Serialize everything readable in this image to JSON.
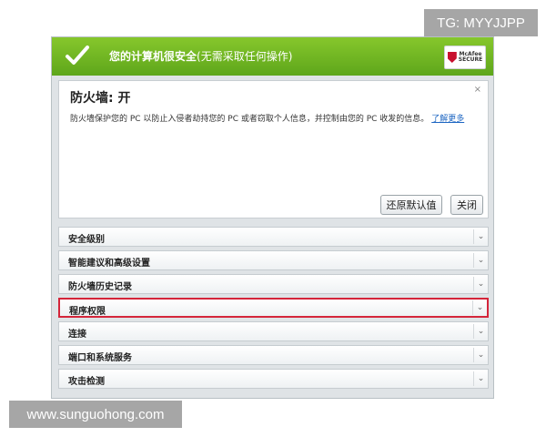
{
  "watermark_tg": "TG: MYYJJPP",
  "watermark_site": "www.sunguohong.com",
  "banner": {
    "status_main": "您的计算机很安全",
    "status_sub": "(无需采取任何操作)",
    "logo_line1": "McAfee",
    "logo_line2": "SECURE"
  },
  "firewall": {
    "title": "防火墙: 开",
    "description": "防火墙保护您的 PC 以防止入侵者劫持您的 PC 或者窃取个人信息，并控制由您的 PC 收发的信息。",
    "learn_more": "了解更多",
    "close_x": "×",
    "restore_button": "还原默认值",
    "close_button": "关闭"
  },
  "sections": [
    {
      "label": "安全级别",
      "highlighted": false
    },
    {
      "label": "智能建议和高级设置",
      "highlighted": false
    },
    {
      "label": "防火墙历史记录",
      "highlighted": false
    },
    {
      "label": "程序权限",
      "highlighted": true
    },
    {
      "label": "连接",
      "highlighted": false
    },
    {
      "label": "端口和系统服务",
      "highlighted": false
    },
    {
      "label": "攻击检测",
      "highlighted": false
    }
  ],
  "icons": {
    "banner": "check-icon",
    "logo": "mcafee-shield-icon",
    "expand": "chevron-down-icon"
  },
  "colors": {
    "banner_green": "#6db520",
    "highlight_red": "#d4253a",
    "link_blue": "#1d66c2"
  }
}
